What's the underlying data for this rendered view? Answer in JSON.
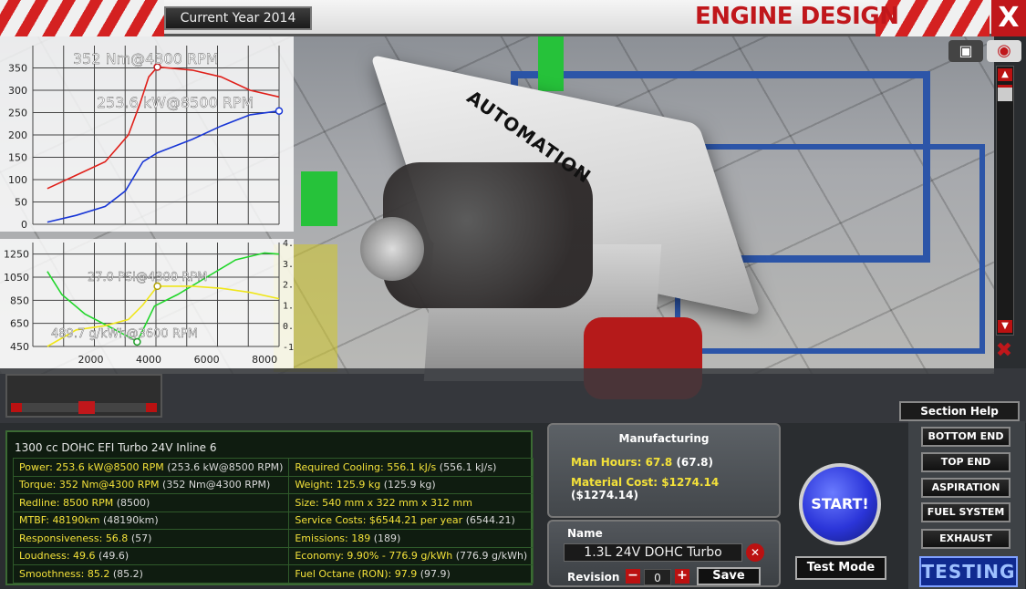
{
  "header": {
    "year_label": "Current Year 2014",
    "title": "ENGINE DESIGN",
    "close_label": "X"
  },
  "viewport": {
    "engine_logo": "AUTOMATION",
    "camera_icon": "camera-icon",
    "eye_icon": "eye-icon",
    "scroll_up": "▲",
    "scroll_down": "▼",
    "nav_icon": "move-cross-icon"
  },
  "chart_data": [
    {
      "type": "line",
      "xlim": [
        0,
        8500
      ],
      "ylim": [
        0,
        400
      ],
      "y_ticks": [
        "0",
        "50",
        "100",
        "150",
        "200",
        "250",
        "300",
        "350"
      ],
      "annotations": [
        "352 Nm@4300 RPM",
        "253.6 kW@8500 RPM"
      ],
      "series": [
        {
          "color": "#e0201a",
          "points": [
            [
              500,
              80
            ],
            [
              1500,
              110
            ],
            [
              2500,
              140
            ],
            [
              3300,
              200
            ],
            [
              3700,
              270
            ],
            [
              4000,
              330
            ],
            [
              4300,
              352
            ],
            [
              5500,
              345
            ],
            [
              6500,
              330
            ],
            [
              7500,
              300
            ],
            [
              8500,
              285
            ]
          ]
        },
        {
          "color": "#1836d6",
          "points": [
            [
              500,
              5
            ],
            [
              1500,
              20
            ],
            [
              2500,
              40
            ],
            [
              3200,
              75
            ],
            [
              3800,
              140
            ],
            [
              4300,
              160
            ],
            [
              5500,
              190
            ],
            [
              6500,
              220
            ],
            [
              7500,
              245
            ],
            [
              8500,
              253.6
            ]
          ]
        }
      ]
    },
    {
      "type": "line",
      "xlim": [
        0,
        8500
      ],
      "ylim": [
        450,
        1350
      ],
      "y2lim": [
        -1.0,
        4.0
      ],
      "y_ticks": [
        "450",
        "650",
        "850",
        "1050",
        "1250"
      ],
      "y2_ticks": [
        "-1.0",
        "0.0",
        "1.0",
        "2.0",
        "3.0",
        "4.0"
      ],
      "x_ticks": [
        "2000",
        "4000",
        "6000",
        "8000"
      ],
      "annotations": [
        "27.0 PSI@4300 RPM",
        "489.7 g/kWh@3600 RPM"
      ],
      "series": [
        {
          "color": "#20d62a",
          "axis": "left",
          "points": [
            [
              500,
              1100
            ],
            [
              1000,
              900
            ],
            [
              1800,
              730
            ],
            [
              2800,
              600
            ],
            [
              3400,
              520
            ],
            [
              3600,
              489.7
            ],
            [
              4200,
              800
            ],
            [
              5000,
              900
            ],
            [
              6000,
              1050
            ],
            [
              7000,
              1200
            ],
            [
              8000,
              1260
            ],
            [
              8500,
              1250
            ]
          ]
        },
        {
          "color": "#f0e61a",
          "axis": "right",
          "points": [
            [
              500,
              -1.0
            ],
            [
              1500,
              -0.2
            ],
            [
              2500,
              0.0
            ],
            [
              3300,
              0.3
            ],
            [
              3800,
              1.0
            ],
            [
              4300,
              1.9
            ],
            [
              5500,
              1.9
            ],
            [
              6500,
              1.8
            ],
            [
              7500,
              1.6
            ],
            [
              8500,
              1.3
            ]
          ]
        }
      ]
    }
  ],
  "stats": {
    "title": "1300 cc DOHC EFI Turbo 24V Inline 6",
    "rows": [
      {
        "l_key": "Power:",
        "l_val": "253.6 kW@8500 RPM",
        "l_ref": "(253.6 kW@8500 RPM)",
        "r_key": "Required Cooling:",
        "r_val": "556.1 kJ/s",
        "r_ref": "(556.1 kJ/s)"
      },
      {
        "l_key": "Torque:",
        "l_val": "352 Nm@4300 RPM",
        "l_ref": "(352 Nm@4300 RPM)",
        "r_key": "Weight:",
        "r_val": "125.9 kg",
        "r_ref": "(125.9 kg)"
      },
      {
        "l_key": "Redline:",
        "l_val": "8500 RPM",
        "l_ref": "(8500)",
        "r_key": "Size:",
        "r_val": "540 mm x 322 mm x 312 mm",
        "r_ref": ""
      },
      {
        "l_key": "MTBF:",
        "l_val": "48190km",
        "l_ref": "(48190km)",
        "r_key": "Service Costs:",
        "r_val": "$6544.21 per year",
        "r_ref": "(6544.21)"
      },
      {
        "l_key": "Responsiveness:",
        "l_val": "56.8",
        "l_ref": "(57)",
        "r_key": "Emissions:",
        "r_val": "189",
        "r_ref": "(189)"
      },
      {
        "l_key": "Loudness:",
        "l_val": "49.6",
        "l_ref": "(49.6)",
        "r_key": "Economy:",
        "r_val": "9.90% - 776.9 g/kWh",
        "r_ref": "(776.9 g/kWh)"
      },
      {
        "l_key": "Smoothness:",
        "l_val": "85.2",
        "l_ref": "(85.2)",
        "r_key": "Fuel Octane (RON):",
        "r_val": "97.9",
        "r_ref": "(97.9)"
      }
    ]
  },
  "manufacturing": {
    "title": "Manufacturing",
    "man_hours_label": "Man Hours:",
    "man_hours_value": "67.8",
    "man_hours_ref": "(67.8)",
    "material_label": "Material Cost:",
    "material_value": "$1274.14",
    "material_ref": "($1274.14)"
  },
  "name_panel": {
    "name_label": "Name",
    "name_value": "1.3L 24V DOHC Turbo",
    "revision_label": "Revision",
    "revision_value": "0",
    "minus": "−",
    "plus": "+",
    "save_label": "Save"
  },
  "actions": {
    "start_label": "START!",
    "test_mode_label": "Test Mode",
    "section_help_label": "Section Help"
  },
  "sections": {
    "items": [
      "BOTTOM END",
      "TOP END",
      "ASPIRATION",
      "FUEL SYSTEM",
      "EXHAUST"
    ],
    "testing_label": "TESTING"
  },
  "colors": {
    "accent_red": "#c0171b",
    "value_yellow": "#f3e13a",
    "panel_green": "#0f1c10"
  }
}
